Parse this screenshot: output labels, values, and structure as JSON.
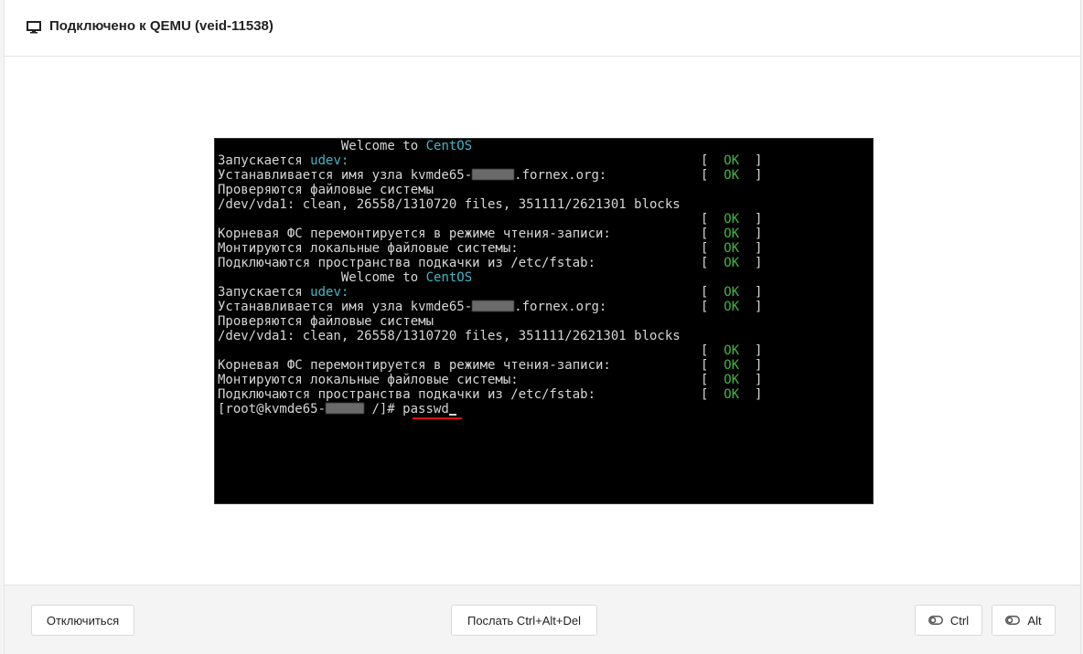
{
  "header": {
    "icon": "monitor-icon",
    "title": "Подключено к QEMU (veid-11538)"
  },
  "terminal": {
    "welcome": "Welcome to",
    "distro": "CentOS",
    "udev_label": "Запускается",
    "udev_value": "udev:",
    "hostname_prefix": "Устанавливается имя узла kvmde65-",
    "hostname_suffix": ".fornex.org:",
    "fs_check": "Проверяются файловые системы",
    "fs_result": "/dev/vda1: clean, 26558/1310720 files, 351111/2621301 blocks",
    "remount": "Корневая ФС перемонтируется в режиме чтения-записи:",
    "mount_local": "Монтируются локальные файловые системы:",
    "swap": "Подключаются пространства подкачки из /etc/fstab:",
    "status_open": "[",
    "status_ok": "OK",
    "status_close": "]",
    "prompt_prefix": "[root@kvmde65-",
    "prompt_suffix": " /]#",
    "command": "passwd",
    "colors": {
      "background": "#000000",
      "text": "#d6d6d6",
      "ok": "#3fb83f",
      "distro": "#3fb8c8",
      "command_underline": "#e01010"
    }
  },
  "footer": {
    "disconnect_label": "Отключиться",
    "ctrl_alt_del_label": "Послать Ctrl+Alt+Del",
    "ctrl_label": "Ctrl",
    "alt_label": "Alt",
    "toggle_icon": "toggle-icon"
  }
}
